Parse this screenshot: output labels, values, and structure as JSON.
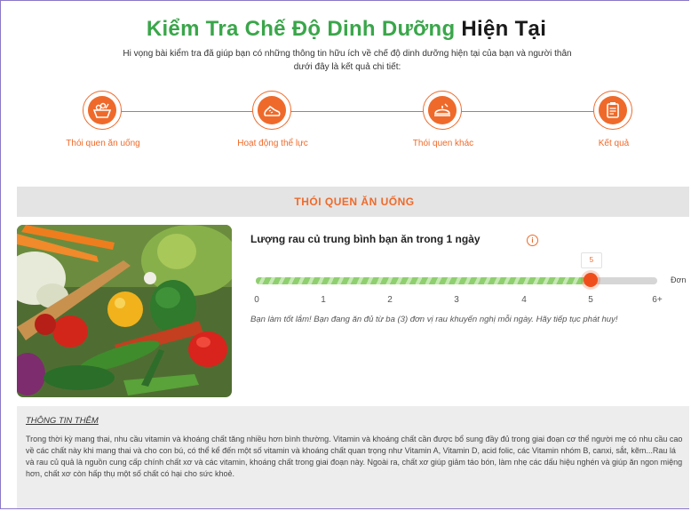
{
  "header": {
    "title_green": "Kiểm Tra Chế Độ Dinh Dưỡng",
    "title_black": "Hiện Tại",
    "subtitle": "Hi vọng bài kiểm tra đã giúp bạn có những thông tin hữu ích về chế độ dinh dưỡng hiện tại của bạn và người thân dưới đây là kết quả chi tiết:"
  },
  "steps": [
    {
      "label": "Thói quen ăn uống",
      "icon": "food-basket-icon"
    },
    {
      "label": "Hoạt động thể lực",
      "icon": "running-shoe-icon"
    },
    {
      "label": "Thói quen khác",
      "icon": "food-tray-icon"
    },
    {
      "label": "Kết quả",
      "icon": "clipboard-icon"
    }
  ],
  "section": {
    "title": "THÓI QUEN ĂN UỐNG"
  },
  "question": {
    "title": "Lượng rau củ trung bình bạn ăn trong 1 ngày",
    "info_icon": "info-icon",
    "slider_value": 5,
    "slider_value_label": "5",
    "slider_min": 0,
    "slider_max": 6,
    "unit": "Đơn",
    "ticks": [
      "0",
      "1",
      "2",
      "3",
      "4",
      "5",
      "6+"
    ],
    "feedback": "Bạn làm tốt lắm! Bạn đang ăn đủ từ ba (3) đơn vị rau khuyến nghị mỗi ngày. Hãy tiếp tục phát huy!"
  },
  "more_info": {
    "title": "THÔNG TIN THÊM",
    "text": "Trong thời kỳ mang thai, nhu cầu vitamin và khoáng chất tăng nhiều hơn bình thường. Vitamin và khoáng chất cần được bổ sung đầy đủ trong giai đoạn cơ thể người mẹ có nhu cầu cao về các chất này khi mang thai và cho con bú, có thể kể đến một số vitamin và khoáng chất quan trọng như Vitamin A, Vitamin D, acid folic, các Vitamin nhóm B, canxi, sắt, kẽm...Rau lá và rau củ quả là nguồn cung cấp chính chất xơ và các vitamin, khoáng chất trong giai đoạn này. Ngoài ra, chất xơ giúp giảm táo bón, làm nhẹ các dấu hiệu nghén và giúp ăn ngon miệng hơn, chất xơ còn hấp thụ một số chất có hại cho sức khoẻ."
  },
  "colors": {
    "accent": "#ef6a2a",
    "title_green": "#3aa64a",
    "slider_fill": "#8fcf6f"
  }
}
